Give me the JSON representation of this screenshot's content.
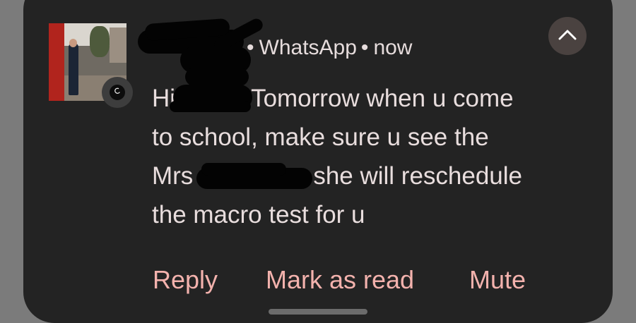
{
  "notification": {
    "app_name": "WhatsApp",
    "separator": "•",
    "time": "now",
    "app_icon": "whatsapp-glyph-icon",
    "collapse_icon": "chevron-up-icon",
    "message": {
      "line1_start": "Hi",
      "line1_end": "Tomorrow when u come",
      "line2": "to school, make sure u see the",
      "line3_start": "Mrs",
      "line3_end": "she will reschedule",
      "line4": "the macro test for u"
    }
  },
  "actions": {
    "reply": "Reply",
    "mark_as_read": "Mark as read",
    "mute": "Mute"
  },
  "colors": {
    "card_background": "#232323",
    "action_text": "#f3b2ad",
    "body_text": "#e8dddd"
  }
}
